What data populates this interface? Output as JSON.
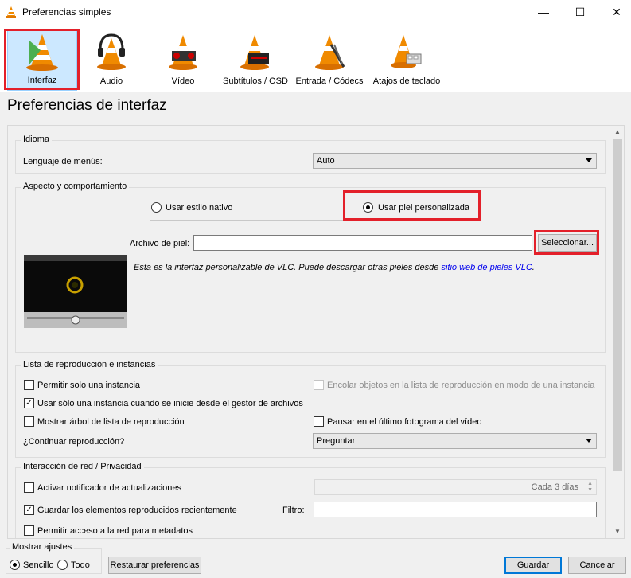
{
  "window": {
    "title": "Preferencias simples",
    "minimize": "—",
    "maximize": "☐",
    "close": "✕"
  },
  "categories": [
    {
      "label": "Interfaz",
      "icon": "vlc-cone-interface-icon",
      "selected": true
    },
    {
      "label": "Audio",
      "icon": "vlc-cone-headphones-icon",
      "selected": false
    },
    {
      "label": "Vídeo",
      "icon": "vlc-cone-video-icon",
      "selected": false
    },
    {
      "label": "Subtítulos / OSD",
      "icon": "vlc-cone-subtitles-icon",
      "selected": false
    },
    {
      "label": "Entrada / Códecs",
      "icon": "vlc-cone-input-icon",
      "selected": false
    },
    {
      "label": "Atajos de teclado",
      "icon": "vlc-cone-hotkeys-icon",
      "selected": false
    }
  ],
  "section_title": "Preferencias de interfaz",
  "idioma": {
    "title": "Idioma",
    "menu_language_label": "Lenguaje de menús:",
    "menu_language_value": "Auto"
  },
  "aspecto": {
    "title": "Aspecto y comportamiento",
    "native_style_label": "Usar estilo nativo",
    "native_style_checked": false,
    "custom_skin_label": "Usar piel personalizada",
    "custom_skin_checked": true,
    "skin_file_label": "Archivo de piel:",
    "skin_file_value": "",
    "select_button": "Seleccionar...",
    "description": "Esta es la interfaz personalizable de VLC. Puede descargar otras pieles desde ",
    "link_text": "sitio web de pieles VLC",
    "description_end": "."
  },
  "lista": {
    "title": "Lista de reproducción e instancias",
    "one_instance": {
      "label": "Permitir solo una instancia",
      "checked": false
    },
    "enqueue": {
      "label": "Encolar objetos en la lista de reproducción en modo de una instancia",
      "checked": false,
      "disabled": true
    },
    "one_instance_fm": {
      "label": "Usar sólo una instancia cuando se inicie desde el gestor de archivos",
      "checked": true
    },
    "tree": {
      "label": "Mostrar árbol de lista de reproducción",
      "checked": false
    },
    "pause_last": {
      "label": "Pausar en el último fotograma del vídeo",
      "checked": false
    },
    "continue_label": "¿Continuar reproducción?",
    "continue_value": "Preguntar"
  },
  "red": {
    "title": "Interacción de red / Privacidad",
    "updates": {
      "label": "Activar notificador de actualizaciones",
      "checked": false
    },
    "updates_interval": "Cada 3 días",
    "recent": {
      "label": "Guardar los elementos reproducidos recientemente",
      "checked": true
    },
    "filter_label": "Filtro:",
    "filter_value": "",
    "metadata": {
      "label": "Permitir acceso a la red para metadatos",
      "checked": false
    }
  },
  "bottom": {
    "show_settings_title": "Mostrar ajustes",
    "simple_label": "Sencillo",
    "simple_checked": true,
    "all_label": "Todo",
    "all_checked": false,
    "reset_button": "Restaurar preferencias",
    "save_button": "Guardar",
    "cancel_button": "Cancelar"
  },
  "colors": {
    "highlight_red": "#e3202a",
    "link_blue": "#0000ee",
    "default_button_border": "#0078d7",
    "vlc_orange": "#f08a00"
  }
}
